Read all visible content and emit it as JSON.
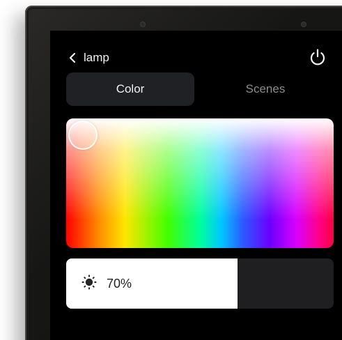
{
  "header": {
    "back_icon": "chevron-left-icon",
    "device_name": "lamp",
    "power_icon": "power-icon"
  },
  "tabs": [
    {
      "label": "Color",
      "active": true
    },
    {
      "label": "Scenes",
      "active": false
    }
  ],
  "color_picker": {
    "selected_color": "#ffffff"
  },
  "brightness": {
    "icon": "brightness-icon",
    "value_text": "70%",
    "level": 0.64,
    "fill_color": "#ffffff",
    "track_color": "#1f1f21"
  },
  "colors": {
    "screen_bg": "#000000",
    "active_tab_bg": "#202124"
  }
}
